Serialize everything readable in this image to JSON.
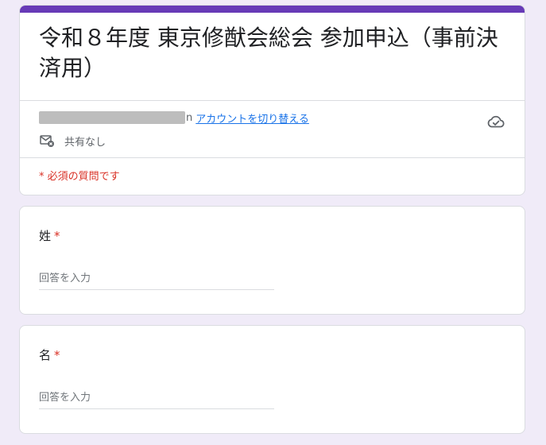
{
  "form": {
    "title": "令和８年度 東京修猷会総会 参加申込（事前決済用）",
    "account": {
      "email_tail": "n",
      "switch_label": "アカウントを切り替える"
    },
    "share_status": "共有なし",
    "required_note": "* 必須の質問です"
  },
  "questions": [
    {
      "label": "姓",
      "required_mark": "*",
      "placeholder": "回答を入力"
    },
    {
      "label": "名",
      "required_mark": "*",
      "placeholder": "回答を入力"
    }
  ],
  "colors": {
    "accent": "#673ab7",
    "background": "#f0ebf8",
    "link": "#1a73e8",
    "required": "#d93025"
  },
  "icons": [
    "cloud-check-icon",
    "mail-shared-icon"
  ]
}
